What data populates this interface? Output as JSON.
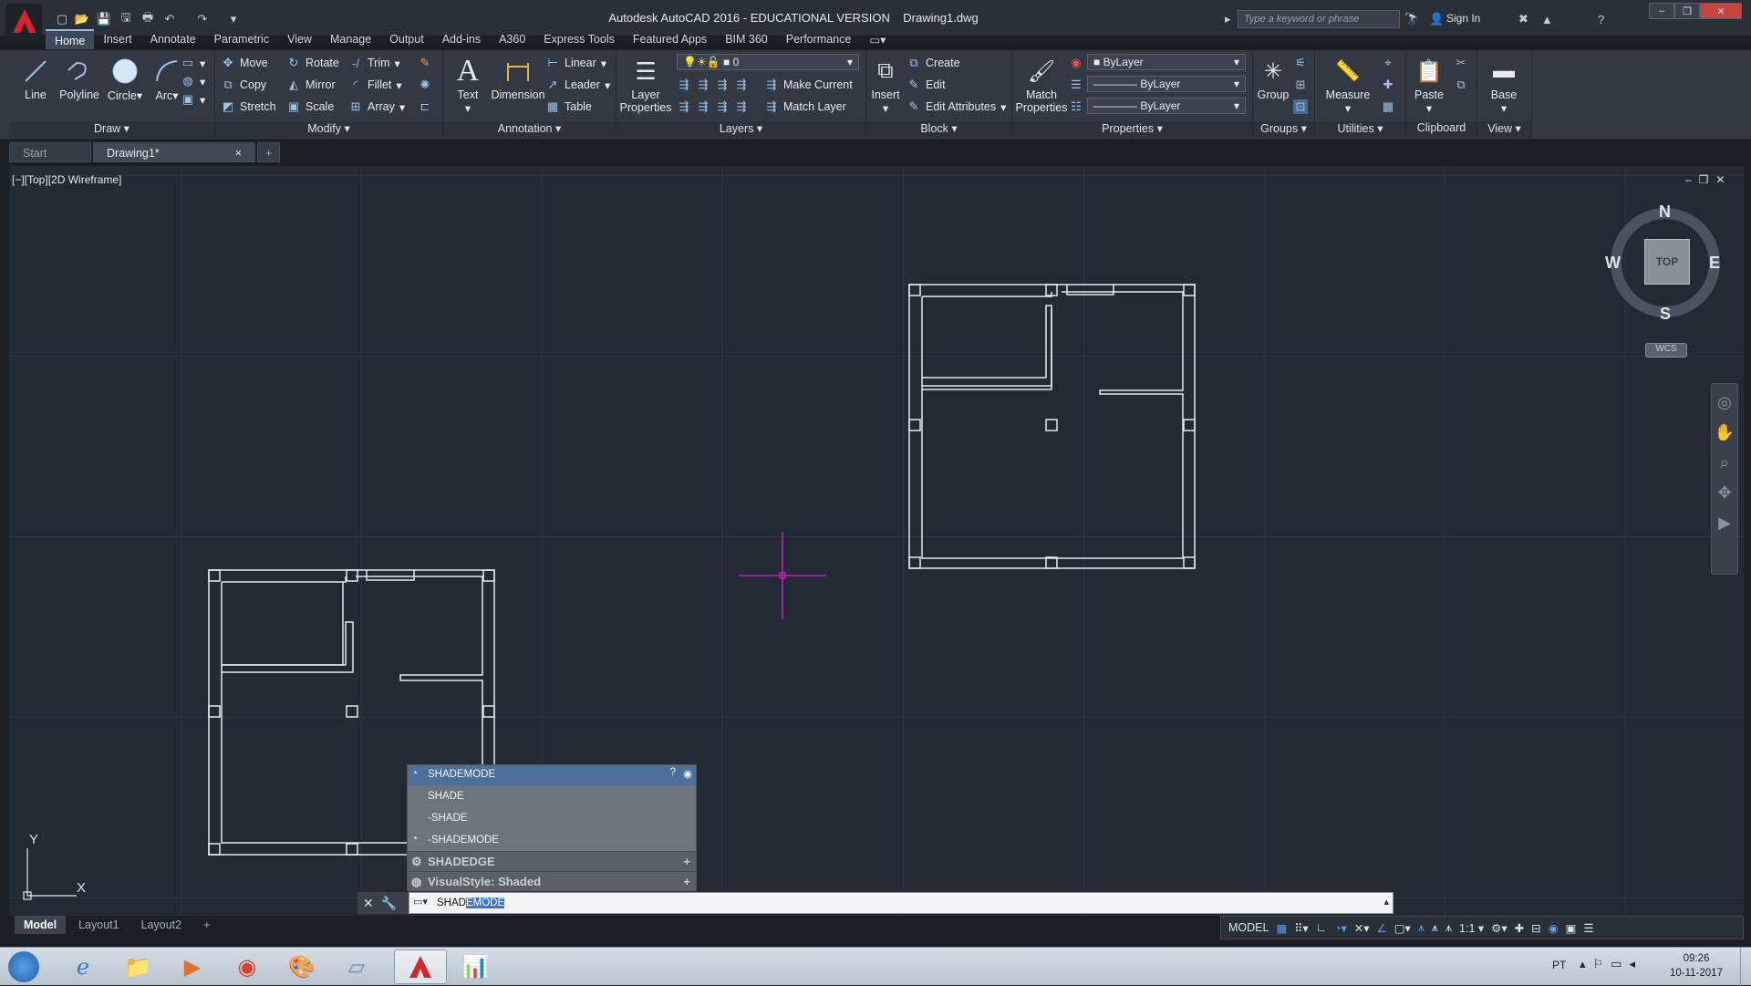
{
  "app": {
    "title": "Autodesk AutoCAD 2016 - EDUCATIONAL VERSION",
    "filename": "Drawing1.dwg",
    "search_placeholder": "Type a keyword or phrase",
    "sign_in": "Sign In"
  },
  "ribbon_tabs": [
    "Home",
    "Insert",
    "Annotate",
    "Parametric",
    "View",
    "Manage",
    "Output",
    "Add-ins",
    "A360",
    "Express Tools",
    "Featured Apps",
    "BIM 360",
    "Performance"
  ],
  "draw": {
    "line": "Line",
    "polyline": "Polyline",
    "circle": "Circle",
    "arc": "Arc",
    "label": "Draw"
  },
  "modify": {
    "move": "Move",
    "rotate": "Rotate",
    "trim": "Trim",
    "copy": "Copy",
    "mirror": "Mirror",
    "fillet": "Fillet",
    "stretch": "Stretch",
    "scale": "Scale",
    "array": "Array",
    "label": "Modify"
  },
  "annotation": {
    "text": "Text",
    "dimension": "Dimension",
    "linear": "Linear",
    "leader": "Leader",
    "table": "Table",
    "label": "Annotation"
  },
  "layers": {
    "layer_properties": "Layer Properties",
    "current_layer": "0",
    "make_current": "Make Current",
    "match_layer": "Match Layer",
    "label": "Layers"
  },
  "block": {
    "insert": "Insert",
    "create": "Create",
    "edit": "Edit",
    "edit_attributes": "Edit Attributes",
    "label": "Block"
  },
  "properties": {
    "match_properties": "Match Properties",
    "color": "ByLayer",
    "linetype": "ByLayer",
    "lineweight": "ByLayer",
    "label": "Properties"
  },
  "groups": {
    "group": "Group",
    "label": "Groups"
  },
  "utilities": {
    "measure": "Measure",
    "label": "Utilities"
  },
  "clipboard": {
    "paste": "Paste",
    "label": "Clipboard"
  },
  "view": {
    "base": "Base",
    "label": "View"
  },
  "file_tabs": {
    "start": "Start",
    "drawing": "Drawing1*"
  },
  "viewport": {
    "label": "[−][Top][2D Wireframe]",
    "ucs_x": "X",
    "ucs_y": "Y"
  },
  "viewcube": {
    "n": "N",
    "s": "S",
    "e": "E",
    "w": "W",
    "top": "TOP",
    "wcs": "WCS"
  },
  "autocomplete": {
    "header": "SHADEMODE",
    "items": [
      "SHADE",
      "-SHADE",
      "-SHADEMODE"
    ],
    "sysvar": "SHADEDGE",
    "visual_style": "VisualStyle: Shaded"
  },
  "command": {
    "typed": "SHAD",
    "suggest": "EMODE"
  },
  "layout_tabs": [
    "Model",
    "Layout1",
    "Layout2"
  ],
  "status": {
    "model": "MODEL",
    "scale": "1:1"
  },
  "tray": {
    "lang": "PT",
    "time": "09:26",
    "date": "10-11-2017"
  },
  "colors": {
    "accent": "#3b4a5c",
    "crosshair": "#c020c0",
    "viewport_bg": "#232a34"
  }
}
